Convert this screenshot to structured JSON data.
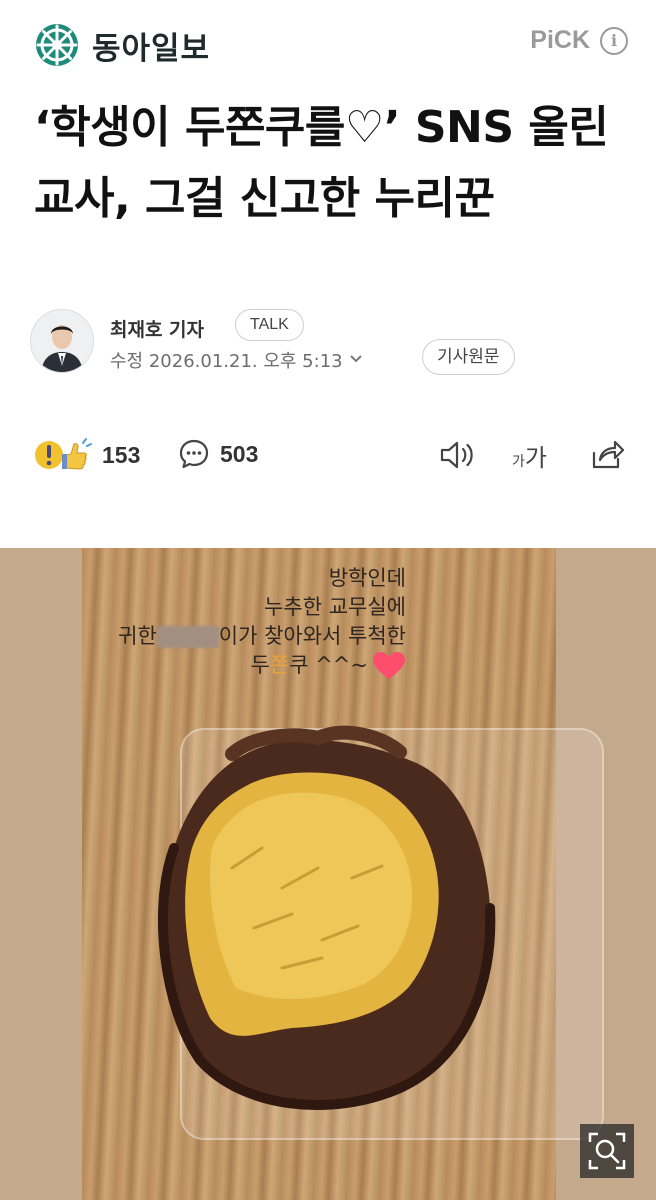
{
  "header": {
    "brand": "동아일보",
    "pick_label": "PiCK"
  },
  "article": {
    "headline": "‘학생이 두쫀쿠를♡’ SNS 올린 교사, 그걸 신고한 누리꾼",
    "author": "최재호 기자",
    "talk_label": "TALK",
    "date": "수정 2026.01.21. 오후 5:13",
    "source_label": "기사원문"
  },
  "actions": {
    "reaction_count": "153",
    "comment_count": "503",
    "font_size_small": "가",
    "font_size_big": "가"
  },
  "photo": {
    "caption_lines": [
      "방학인데",
      "누추한 교무실에",
      "귀한",
      "이가 찾아와서 투척한",
      "두쫀쿠 ^^~"
    ],
    "accent_color": "#e8a33a",
    "heart_color": "#ff4d6d"
  }
}
